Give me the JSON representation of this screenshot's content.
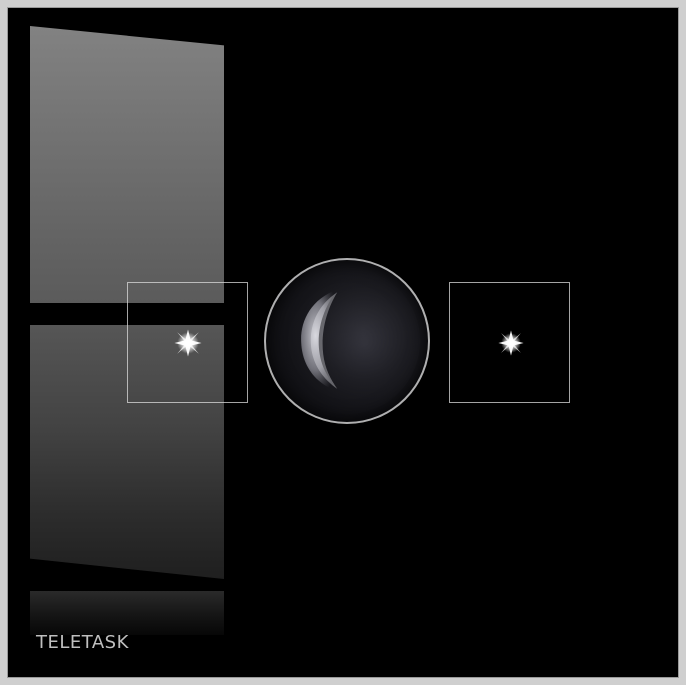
{
  "brand": {
    "label": "TELETASK"
  },
  "keys": [
    {
      "name": "left",
      "icon": "sparkle-icon"
    },
    {
      "name": "center",
      "icon": "moon-icon"
    },
    {
      "name": "right",
      "icon": "sparkle-icon"
    }
  ],
  "colors": {
    "panel_background": "#000000",
    "key_outline": "#dcdcdc",
    "brand_text": "#bfbfbf",
    "frame_border": "#9a9a9a"
  }
}
